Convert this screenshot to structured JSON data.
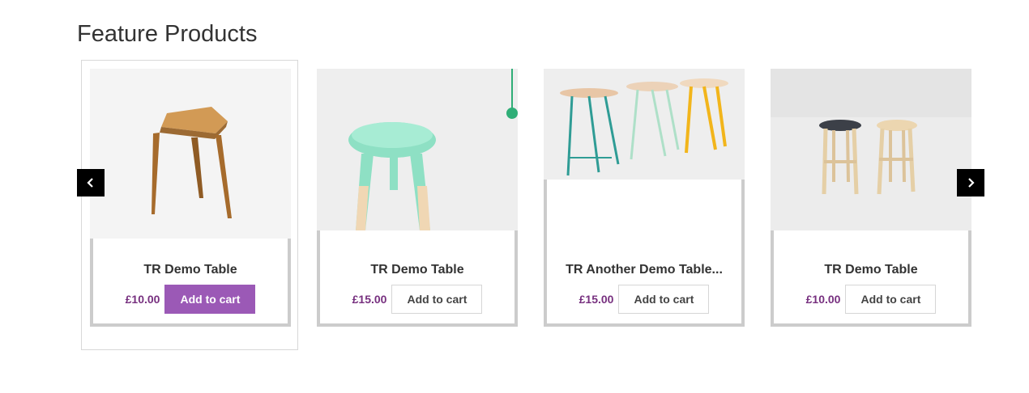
{
  "section": {
    "title": "Feature Products"
  },
  "carousel": {
    "prev_icon": "chevron-left-icon",
    "next_icon": "chevron-right-icon"
  },
  "products": [
    {
      "name": "TR Demo Table",
      "price": "£10.00",
      "button": "Add to cart",
      "highlighted": true,
      "image": "wooden three-legged stool"
    },
    {
      "name": "TR Demo Table",
      "price": "£15.00",
      "button": "Add to cart",
      "highlighted": false,
      "image": "mint green dipped stool"
    },
    {
      "name": "TR Another Demo Table...",
      "price": "£15.00",
      "button": "Add to cart",
      "highlighted": false,
      "image": "three colored metal stools"
    },
    {
      "name": "TR Demo Table",
      "price": "£10.00",
      "button": "Add to cart",
      "highlighted": false,
      "image": "two wooden stools"
    }
  ],
  "colors": {
    "price": "#77307f",
    "accent_button": "#9b59b6",
    "card_border": "#cccccc",
    "arrow_bg": "#000000"
  }
}
